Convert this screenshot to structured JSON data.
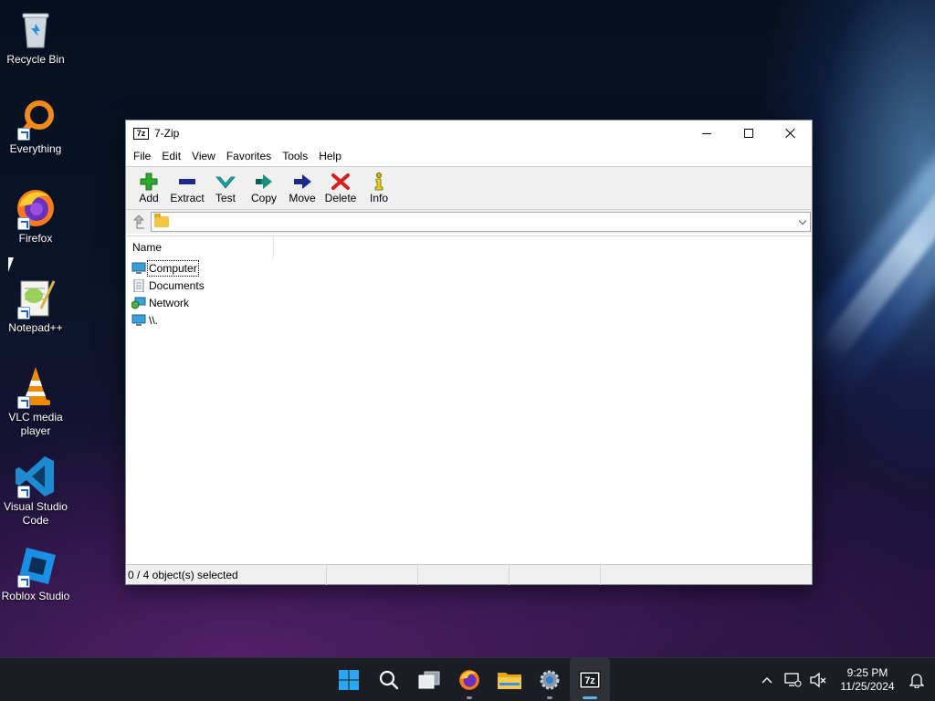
{
  "desktop": {
    "icons": [
      {
        "label": "Recycle Bin"
      },
      {
        "label": "Everything"
      },
      {
        "label": "Firefox"
      },
      {
        "label": "Notepad++"
      },
      {
        "label": "VLC media player"
      },
      {
        "label": "Visual Studio Code"
      },
      {
        "label": "Roblox Studio"
      }
    ]
  },
  "window": {
    "app_icon_text": "7z",
    "title": "7-Zip",
    "menu": [
      "File",
      "Edit",
      "View",
      "Favorites",
      "Tools",
      "Help"
    ],
    "toolbar": [
      {
        "label": "Add",
        "icon": "plus-icon",
        "color": "#2fa82f"
      },
      {
        "label": "Extract",
        "icon": "minus-icon",
        "color": "#1c2a8c"
      },
      {
        "label": "Test",
        "icon": "check-icon",
        "color": "#18a5a5"
      },
      {
        "label": "Copy",
        "icon": "double-arrow-icon",
        "color": "#18907a"
      },
      {
        "label": "Move",
        "icon": "arrow-right-icon",
        "color": "#1c2a8c"
      },
      {
        "label": "Delete",
        "icon": "x-icon",
        "color": "#d62020"
      },
      {
        "label": "Info",
        "icon": "info-icon",
        "color": "#c9b400"
      }
    ],
    "address": {
      "value": "",
      "placeholder": ""
    },
    "list": {
      "columns": [
        "Name"
      ],
      "rows": [
        {
          "name": "Computer",
          "icon": "computer-icon"
        },
        {
          "name": "Documents",
          "icon": "documents-icon"
        },
        {
          "name": "Network",
          "icon": "network-icon"
        },
        {
          "name": "\\\\.",
          "icon": "computer-icon"
        }
      ]
    },
    "status": {
      "selection": "0 / 4 object(s) selected"
    }
  },
  "taskbar": {
    "apps": [
      "start-icon",
      "search-icon",
      "task-view-icon",
      "firefox-icon",
      "file-explorer-icon",
      "settings-icon",
      "7zip-icon"
    ],
    "clock_time": "9:25 PM",
    "clock_date": "11/25/2024"
  },
  "colors": {
    "accent": "#5fb2f2",
    "taskbar": "#1b1d24"
  }
}
